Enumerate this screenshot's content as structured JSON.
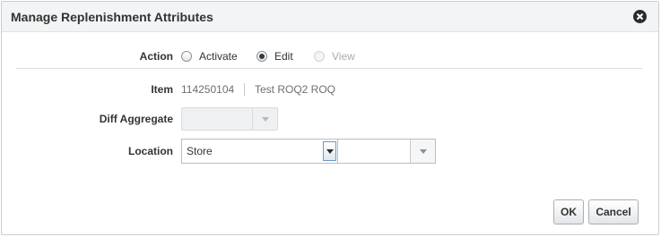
{
  "dialog": {
    "title": "Manage Replenishment Attributes",
    "close_icon": "close-circle-icon"
  },
  "action": {
    "label": "Action",
    "options": [
      {
        "label": "Activate",
        "checked": false,
        "disabled": false
      },
      {
        "label": "Edit",
        "checked": true,
        "disabled": false
      },
      {
        "label": "View",
        "checked": false,
        "disabled": true
      }
    ]
  },
  "item": {
    "label": "Item",
    "number": "114250104",
    "description": "Test ROQ2 ROQ"
  },
  "diff_aggregate": {
    "label": "Diff Aggregate",
    "value": "",
    "disabled": true
  },
  "location": {
    "label": "Location",
    "type_value": "Store",
    "location_value": ""
  },
  "buttons": {
    "ok": "OK",
    "cancel": "Cancel"
  }
}
